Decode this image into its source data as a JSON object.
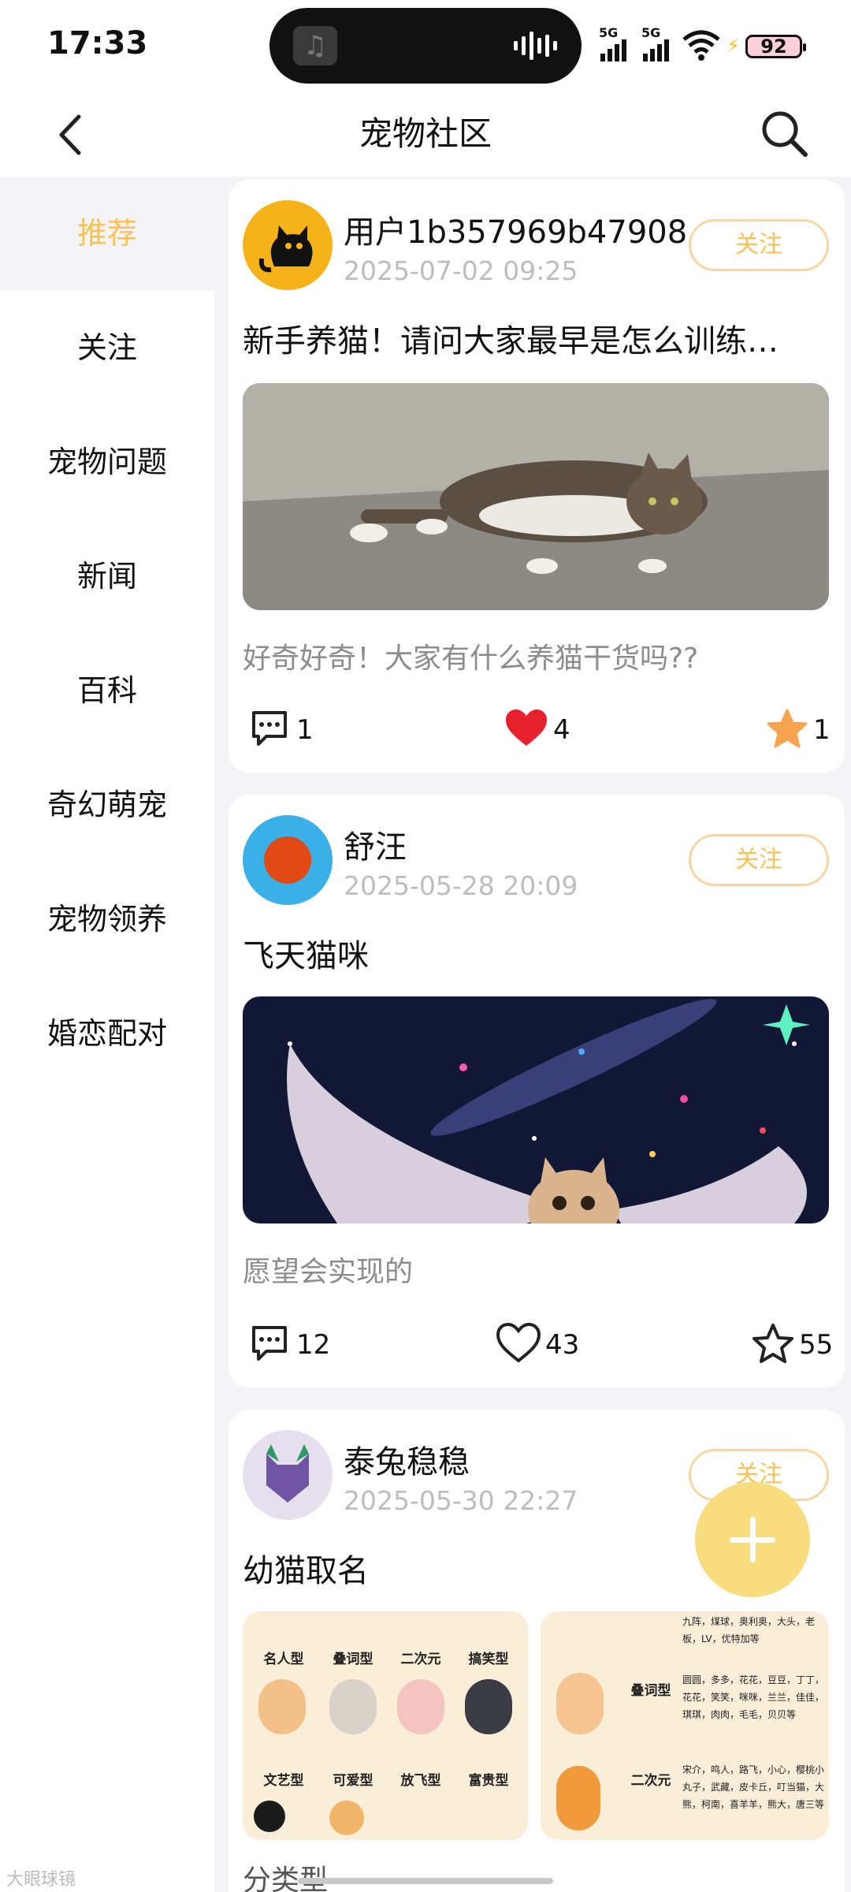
{
  "status_bar": {
    "time": "17:33",
    "signal1": "5G",
    "signal2": "5G",
    "battery": "92"
  },
  "header": {
    "title": "宠物社区"
  },
  "sidebar": {
    "items": [
      {
        "label": "推荐",
        "active": true
      },
      {
        "label": "关注"
      },
      {
        "label": "宠物问题"
      },
      {
        "label": "新闻"
      },
      {
        "label": "百科"
      },
      {
        "label": "奇幻萌宠"
      },
      {
        "label": "宠物领养"
      },
      {
        "label": "婚恋配对"
      }
    ]
  },
  "posts": [
    {
      "user": "用户1b357969b47908",
      "date": "2025-07-02 09:25",
      "follow_label": "关注",
      "title": "新手养猫！请问大家最早是怎么训练…",
      "description": "好奇好奇！大家有什么养猫干货吗??",
      "comments": "1",
      "likes": "4",
      "favorites": "1"
    },
    {
      "user": "舒汪",
      "date": "2025-05-28 20:09",
      "follow_label": "关注",
      "title": "飞天猫咪",
      "description": "愿望会实现的",
      "comments": "12",
      "likes": "43",
      "favorites": "55"
    },
    {
      "user": "泰兔稳稳",
      "date": "2025-05-30 22:27",
      "follow_label": "关注",
      "title": "幼猫取名",
      "description": "分类型",
      "poster_left": [
        "名人型",
        "叠词型",
        "二次元",
        "搞笑型",
        "文艺型",
        "可爱型",
        "放飞型",
        "富贵型"
      ],
      "poster_right": {
        "top_names": "九阵，煤球，奥利奥，大头，老板，LV，优特加等",
        "label1": "叠词型",
        "names1": "圆圆，多多，花花，豆豆，丁丁，花花，笑笑，咪咪，兰兰，佳佳，琪琪，肉肉，毛毛，贝贝等",
        "label2": "二次元",
        "names2": "宋介，鸣人，路飞，小心，樱桃小丸子，武藏，皮卡丘，叮当猫，大熊，柯南，喜羊羊，熊大，唐三等"
      }
    }
  ],
  "colors": {
    "accent": "#f4c35a",
    "like_red": "#e8212f",
    "star_orange": "#f6a44f",
    "fab": "#f7dd7f"
  },
  "watermark": "大眼球镜"
}
